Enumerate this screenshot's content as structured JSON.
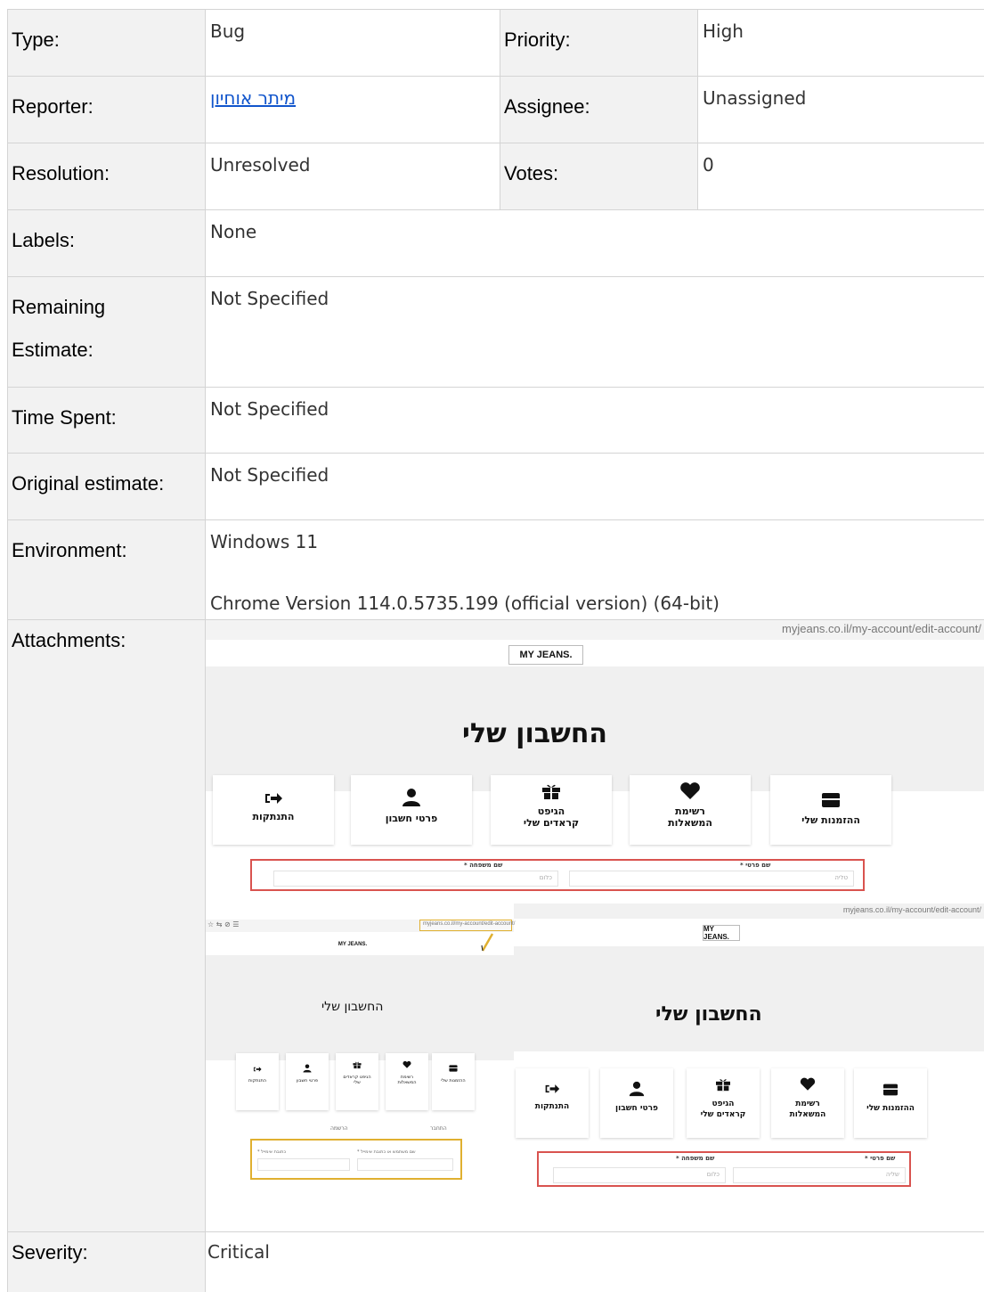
{
  "rows": {
    "type": {
      "label": "Type:",
      "value": "Bug"
    },
    "priority": {
      "label": "Priority:",
      "value": "High"
    },
    "reporter": {
      "label": "Reporter:",
      "value": "מיתר אוחיון"
    },
    "assignee": {
      "label": "Assignee:",
      "value": "Unassigned"
    },
    "resolution": {
      "label": "Resolution:",
      "value": "Unresolved"
    },
    "votes": {
      "label": "Votes:",
      "value": "0"
    },
    "labels": {
      "label": "Labels:",
      "value": "None"
    },
    "remaining_estimate": {
      "label_line1": "Remaining",
      "label_line2": "Estimate:",
      "value": "Not Specified"
    },
    "time_spent": {
      "label": "Time Spent:",
      "value": "Not Specified"
    },
    "original_estimate": {
      "label": "Original estimate:",
      "value": "Not Specified"
    },
    "environment": {
      "label": "Environment:",
      "line1": "Windows 11",
      "line2": "Chrome Version 114.0.5735.199 (official version) (64-bit)"
    },
    "attachments": {
      "label": "Attachments:"
    },
    "severity": {
      "label": "Severity:",
      "value": "Critical"
    }
  },
  "attachment_screenshot": {
    "url": "myjeans.co.il/my-account/edit-account/",
    "url_small": "myjeans.co.il/my-account/edit-account/",
    "logo": "MY JEANS.",
    "page_title": "החשבון שלי",
    "cards": [
      {
        "label": "ההזמנות שלי",
        "icon": "box-icon"
      },
      {
        "label": "רשימת המשאלות",
        "icon": "heart-icon"
      },
      {
        "label": "הגיפט קראדים שלי",
        "icon": "gift-icon"
      },
      {
        "label": "פרטי חשבון",
        "icon": "user-icon"
      },
      {
        "label": "התנתקות",
        "icon": "logout-icon"
      }
    ],
    "first_name_label": "שם פרטי *",
    "last_name_label": "שם משפחה *",
    "first_name_value": "טליה",
    "last_name_value": "כלום",
    "first_name_value_2": "שליה",
    "last_name_value_2": "כלום",
    "small_login": "התחבר",
    "small_register": "הרשמה",
    "small_field_1": "כתובת אימייל *",
    "small_field_2": "שם משתמש או כתובת אימייל *",
    "browser_icons": "☆ ⇆ ⊘ ☰"
  },
  "colors": {
    "link": "#1155cc",
    "label_bg": "#f2f2f2",
    "border": "#d4d4d4",
    "highlight_red": "#d9534f",
    "highlight_yellow": "#e0b030"
  }
}
